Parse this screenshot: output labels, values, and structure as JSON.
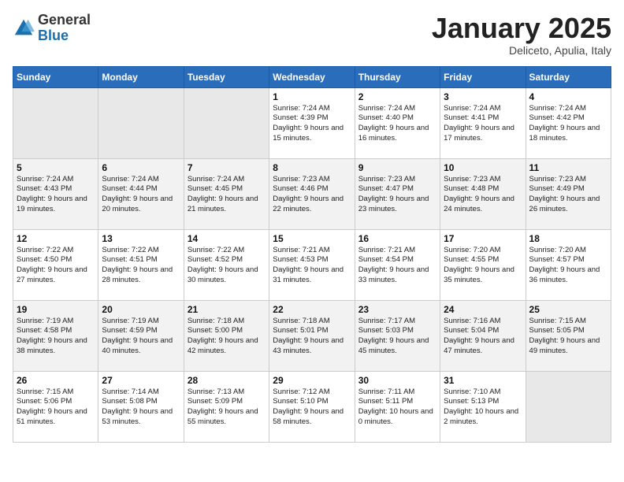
{
  "logo": {
    "general": "General",
    "blue": "Blue"
  },
  "header": {
    "month": "January 2025",
    "location": "Deliceto, Apulia, Italy"
  },
  "weekdays": [
    "Sunday",
    "Monday",
    "Tuesday",
    "Wednesday",
    "Thursday",
    "Friday",
    "Saturday"
  ],
  "weeks": [
    [
      {
        "day": "",
        "empty": true
      },
      {
        "day": "",
        "empty": true
      },
      {
        "day": "",
        "empty": true
      },
      {
        "day": "1",
        "sunrise": "7:24 AM",
        "sunset": "4:39 PM",
        "daylight": "9 hours and 15 minutes."
      },
      {
        "day": "2",
        "sunrise": "7:24 AM",
        "sunset": "4:40 PM",
        "daylight": "9 hours and 16 minutes."
      },
      {
        "day": "3",
        "sunrise": "7:24 AM",
        "sunset": "4:41 PM",
        "daylight": "9 hours and 17 minutes."
      },
      {
        "day": "4",
        "sunrise": "7:24 AM",
        "sunset": "4:42 PM",
        "daylight": "9 hours and 18 minutes."
      }
    ],
    [
      {
        "day": "5",
        "sunrise": "7:24 AM",
        "sunset": "4:43 PM",
        "daylight": "9 hours and 19 minutes."
      },
      {
        "day": "6",
        "sunrise": "7:24 AM",
        "sunset": "4:44 PM",
        "daylight": "9 hours and 20 minutes."
      },
      {
        "day": "7",
        "sunrise": "7:24 AM",
        "sunset": "4:45 PM",
        "daylight": "9 hours and 21 minutes."
      },
      {
        "day": "8",
        "sunrise": "7:23 AM",
        "sunset": "4:46 PM",
        "daylight": "9 hours and 22 minutes."
      },
      {
        "day": "9",
        "sunrise": "7:23 AM",
        "sunset": "4:47 PM",
        "daylight": "9 hours and 23 minutes."
      },
      {
        "day": "10",
        "sunrise": "7:23 AM",
        "sunset": "4:48 PM",
        "daylight": "9 hours and 24 minutes."
      },
      {
        "day": "11",
        "sunrise": "7:23 AM",
        "sunset": "4:49 PM",
        "daylight": "9 hours and 26 minutes."
      }
    ],
    [
      {
        "day": "12",
        "sunrise": "7:22 AM",
        "sunset": "4:50 PM",
        "daylight": "9 hours and 27 minutes."
      },
      {
        "day": "13",
        "sunrise": "7:22 AM",
        "sunset": "4:51 PM",
        "daylight": "9 hours and 28 minutes."
      },
      {
        "day": "14",
        "sunrise": "7:22 AM",
        "sunset": "4:52 PM",
        "daylight": "9 hours and 30 minutes."
      },
      {
        "day": "15",
        "sunrise": "7:21 AM",
        "sunset": "4:53 PM",
        "daylight": "9 hours and 31 minutes."
      },
      {
        "day": "16",
        "sunrise": "7:21 AM",
        "sunset": "4:54 PM",
        "daylight": "9 hours and 33 minutes."
      },
      {
        "day": "17",
        "sunrise": "7:20 AM",
        "sunset": "4:55 PM",
        "daylight": "9 hours and 35 minutes."
      },
      {
        "day": "18",
        "sunrise": "7:20 AM",
        "sunset": "4:57 PM",
        "daylight": "9 hours and 36 minutes."
      }
    ],
    [
      {
        "day": "19",
        "sunrise": "7:19 AM",
        "sunset": "4:58 PM",
        "daylight": "9 hours and 38 minutes."
      },
      {
        "day": "20",
        "sunrise": "7:19 AM",
        "sunset": "4:59 PM",
        "daylight": "9 hours and 40 minutes."
      },
      {
        "day": "21",
        "sunrise": "7:18 AM",
        "sunset": "5:00 PM",
        "daylight": "9 hours and 42 minutes."
      },
      {
        "day": "22",
        "sunrise": "7:18 AM",
        "sunset": "5:01 PM",
        "daylight": "9 hours and 43 minutes."
      },
      {
        "day": "23",
        "sunrise": "7:17 AM",
        "sunset": "5:03 PM",
        "daylight": "9 hours and 45 minutes."
      },
      {
        "day": "24",
        "sunrise": "7:16 AM",
        "sunset": "5:04 PM",
        "daylight": "9 hours and 47 minutes."
      },
      {
        "day": "25",
        "sunrise": "7:15 AM",
        "sunset": "5:05 PM",
        "daylight": "9 hours and 49 minutes."
      }
    ],
    [
      {
        "day": "26",
        "sunrise": "7:15 AM",
        "sunset": "5:06 PM",
        "daylight": "9 hours and 51 minutes."
      },
      {
        "day": "27",
        "sunrise": "7:14 AM",
        "sunset": "5:08 PM",
        "daylight": "9 hours and 53 minutes."
      },
      {
        "day": "28",
        "sunrise": "7:13 AM",
        "sunset": "5:09 PM",
        "daylight": "9 hours and 55 minutes."
      },
      {
        "day": "29",
        "sunrise": "7:12 AM",
        "sunset": "5:10 PM",
        "daylight": "9 hours and 58 minutes."
      },
      {
        "day": "30",
        "sunrise": "7:11 AM",
        "sunset": "5:11 PM",
        "daylight": "10 hours and 0 minutes."
      },
      {
        "day": "31",
        "sunrise": "7:10 AM",
        "sunset": "5:13 PM",
        "daylight": "10 hours and 2 minutes."
      },
      {
        "day": "",
        "empty": true
      }
    ]
  ]
}
